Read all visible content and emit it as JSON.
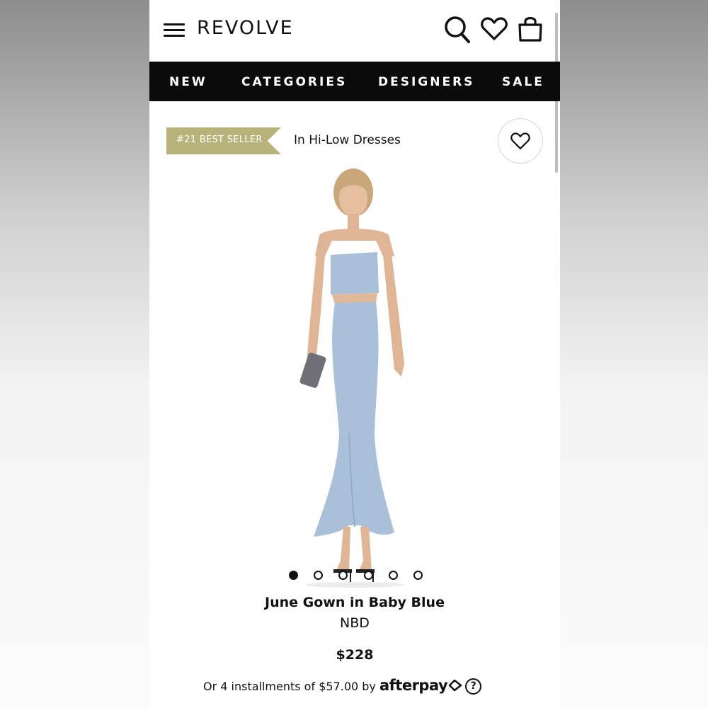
{
  "header": {
    "logo": "REVOLVE",
    "icons": [
      "menu-icon",
      "search-icon",
      "heart-icon",
      "shopping-bag-icon"
    ]
  },
  "nav": {
    "items": [
      "NEW",
      "CATEGORIES",
      "DESIGNERS",
      "SALE"
    ]
  },
  "badge": {
    "best_seller": "#21 BEST SELLER",
    "category": "In Hi-Low Dresses",
    "ribbon_color": "#b7b279"
  },
  "gallery": {
    "total_images": 6,
    "active_index": 0
  },
  "product": {
    "name": "June Gown in Baby Blue",
    "brand": "NBD",
    "price": "$228",
    "dress_color": "#a9c0d8"
  },
  "payment": {
    "text": "Or 4 installments of $57.00 by",
    "provider": "afterpay",
    "help": "?"
  },
  "colors": {
    "nav_bg": "#0b0b0b",
    "text": "#111111"
  }
}
